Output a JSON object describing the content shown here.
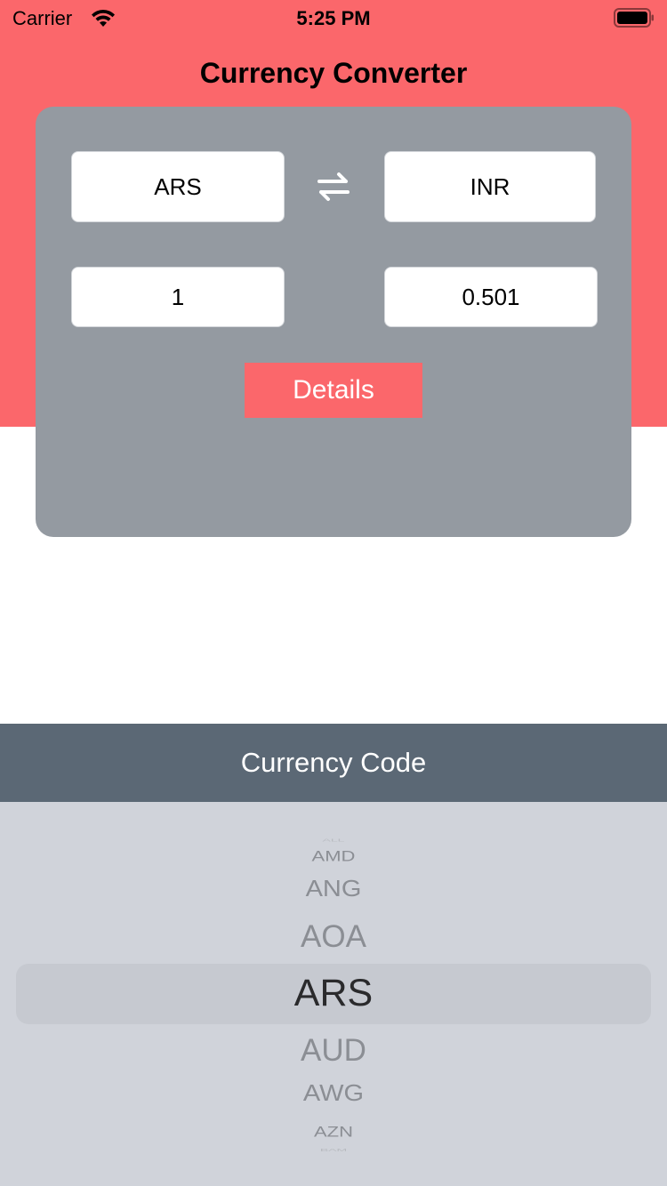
{
  "status_bar": {
    "carrier": "Carrier",
    "time": "5:25 PM",
    "wifi_icon": "wifi-icon",
    "battery_icon": "battery-icon"
  },
  "app": {
    "title": "Currency Converter"
  },
  "converter": {
    "from_code": "ARS",
    "to_code": "INR",
    "swap_icon": "swap-arrows-icon",
    "from_amount": "1",
    "to_amount": "0.501",
    "details_label": "Details"
  },
  "picker": {
    "title": "Currency Code",
    "items": [
      "ALL",
      "AMD",
      "ANG",
      "AOA",
      "ARS",
      "AUD",
      "AWG",
      "AZN",
      "BAM"
    ],
    "selected": "ARS"
  },
  "colors": {
    "accent": "#fb676b",
    "card": "#949aa1",
    "toolbar": "#5b6875",
    "picker_bg": "#d0d3da"
  }
}
